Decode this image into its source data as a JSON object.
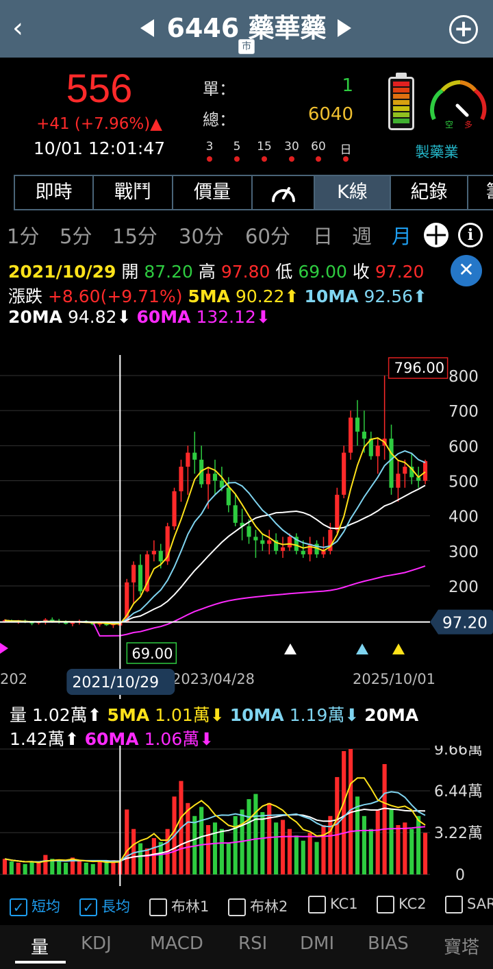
{
  "header": {
    "code": "6446",
    "name": "藥華藥",
    "title": "6446 藥華藥",
    "market_tag": "市"
  },
  "quote": {
    "price": "556",
    "change": "+41 (+7.96%)▲",
    "time": "10/01 12:01:47",
    "single_label": "單：",
    "single_value": "1",
    "total_label": "總：",
    "total_value": "6040",
    "intervals": [
      "3",
      "5",
      "15",
      "30",
      "60",
      "日"
    ],
    "industry": "製藥業",
    "gauge": {
      "left_label": "空",
      "right_label": "多"
    }
  },
  "tabs": [
    "即時",
    "戰鬥",
    "價量",
    "",
    "K線",
    "紀錄",
    "籌"
  ],
  "active_tab": "K線",
  "periods": [
    "1分",
    "5分",
    "15分",
    "30分",
    "60分",
    "日",
    "週",
    "月"
  ],
  "active_period": "月",
  "ohlc": {
    "date": "2021/10/29",
    "open_label": "開",
    "open": "87.20",
    "high_label": "高",
    "high": "97.80",
    "low_label": "低",
    "low": "69.00",
    "close_label": "收",
    "close": "97.20",
    "chg_label": "漲跌",
    "chg": "+8.60(+9.71%)",
    "ma5_label": "5MA",
    "ma5": "90.22",
    "ma10_label": "10MA",
    "ma10": "92.56",
    "ma20_label": "20MA",
    "ma20": "94.82",
    "ma60_label": "60MA",
    "ma60": "132.12"
  },
  "price_chart": {
    "y_ticks": [
      "800",
      "700",
      "600",
      "500",
      "400",
      "300",
      "200"
    ],
    "max_label": "796.00",
    "min_label": "69.00",
    "crosshair_price": "97.20",
    "x_labels": [
      "202",
      "2023/04/28",
      "2025/10/01"
    ],
    "crosshair_date": "2021/10/29"
  },
  "volume": {
    "label": "量",
    "value": "1.02萬",
    "ma5_label": "5MA",
    "ma5": "1.01萬",
    "ma10_label": "10MA",
    "ma10": "1.19萬",
    "ma20_label": "20MA",
    "ma20": "1.42萬",
    "ma60_label": "60MA",
    "ma60": "1.06萬",
    "y_ticks": [
      "9.66萬",
      "6.44萬",
      "3.22萬",
      "0"
    ]
  },
  "overlays": [
    {
      "label": "短均",
      "checked": true
    },
    {
      "label": "長均",
      "checked": true
    },
    {
      "label": "布林1",
      "checked": false
    },
    {
      "label": "布林2",
      "checked": false
    },
    {
      "label": "KC1",
      "checked": false
    },
    {
      "label": "KC2",
      "checked": false
    },
    {
      "label": "SAR",
      "checked": false
    }
  ],
  "indicator_tabs": [
    "量",
    "KDJ",
    "MACD",
    "RSI",
    "DMI",
    "BIAS",
    "寶塔"
  ],
  "active_indicator": "量",
  "colors": {
    "up": "#ff2a2a",
    "down": "#2ecc40",
    "ma5": "#ffe21a",
    "ma10": "#7fd4f0",
    "ma20": "#ffffff",
    "ma60": "#ff2aff",
    "header": "#4a6478",
    "accent": "#1e9ef0"
  },
  "chart_data": {
    "type": "candlestick",
    "title": "",
    "period": "monthly",
    "ylabel": "",
    "ylim": [
      0,
      850
    ],
    "last_close": 556,
    "max_high": 796,
    "min_low": 69,
    "candles_ohlc": [
      [
        100,
        105,
        95,
        102
      ],
      [
        102,
        104,
        96,
        98
      ],
      [
        98,
        103,
        92,
        100
      ],
      [
        100,
        104,
        94,
        96
      ],
      [
        96,
        100,
        88,
        94
      ],
      [
        94,
        99,
        90,
        97
      ],
      [
        97,
        108,
        90,
        104
      ],
      [
        104,
        110,
        95,
        100
      ],
      [
        100,
        106,
        93,
        96
      ],
      [
        96,
        102,
        90,
        92
      ],
      [
        92,
        100,
        85,
        97
      ],
      [
        97,
        104,
        90,
        100
      ],
      [
        100,
        102,
        94,
        95
      ],
      [
        95,
        98,
        88,
        90
      ],
      [
        90,
        96,
        84,
        93
      ],
      [
        93,
        98,
        86,
        88
      ],
      [
        88,
        94,
        80,
        92
      ],
      [
        87.2,
        97.8,
        69,
        97.2
      ],
      [
        97,
        220,
        95,
        210
      ],
      [
        210,
        270,
        150,
        260
      ],
      [
        260,
        290,
        175,
        185
      ],
      [
        185,
        300,
        182,
        290
      ],
      [
        290,
        330,
        270,
        300
      ],
      [
        300,
        320,
        250,
        270
      ],
      [
        270,
        380,
        260,
        370
      ],
      [
        370,
        480,
        360,
        470
      ],
      [
        470,
        560,
        440,
        540
      ],
      [
        540,
        600,
        460,
        580
      ],
      [
        580,
        640,
        520,
        560
      ],
      [
        560,
        600,
        480,
        490
      ],
      [
        490,
        540,
        420,
        520
      ],
      [
        520,
        560,
        460,
        500
      ],
      [
        500,
        540,
        470,
        480
      ],
      [
        480,
        510,
        410,
        430
      ],
      [
        430,
        460,
        370,
        380
      ],
      [
        380,
        420,
        330,
        370
      ],
      [
        370,
        390,
        320,
        340
      ],
      [
        340,
        360,
        280,
        330
      ],
      [
        330,
        350,
        300,
        320
      ],
      [
        320,
        360,
        290,
        330
      ],
      [
        330,
        350,
        290,
        300
      ],
      [
        300,
        340,
        280,
        310
      ],
      [
        310,
        350,
        300,
        340
      ],
      [
        340,
        350,
        290,
        300
      ],
      [
        300,
        330,
        280,
        290
      ],
      [
        290,
        340,
        270,
        320
      ],
      [
        320,
        330,
        280,
        290
      ],
      [
        290,
        340,
        280,
        300
      ],
      [
        300,
        380,
        290,
        360
      ],
      [
        360,
        480,
        350,
        460
      ],
      [
        460,
        600,
        450,
        580
      ],
      [
        580,
        700,
        560,
        680
      ],
      [
        680,
        730,
        600,
        640
      ],
      [
        640,
        700,
        580,
        620
      ],
      [
        620,
        640,
        560,
        570
      ],
      [
        570,
        620,
        520,
        600
      ],
      [
        600,
        800,
        560,
        620
      ],
      [
        620,
        660,
        460,
        480
      ],
      [
        480,
        560,
        440,
        520
      ],
      [
        520,
        560,
        480,
        540
      ],
      [
        540,
        580,
        490,
        510
      ],
      [
        510,
        540,
        480,
        500
      ],
      [
        500,
        560,
        490,
        556
      ]
    ],
    "volume_wan": [
      1.2,
      1.0,
      0.9,
      0.8,
      1.0,
      0.9,
      1.5,
      1.2,
      1.0,
      0.9,
      1.3,
      1.1,
      0.9,
      0.8,
      1.0,
      0.9,
      1.1,
      1.02,
      5.0,
      3.5,
      2.4,
      2.0,
      2.8,
      2.5,
      3.5,
      6.0,
      7.2,
      5.5,
      4.5,
      5.2,
      3.8,
      4.0,
      3.5,
      2.4,
      4.5,
      5.0,
      5.8,
      6.2,
      4.8,
      5.5,
      4.0,
      4.2,
      3.5,
      3.0,
      2.6,
      3.2,
      2.5,
      3.8,
      4.5,
      7.5,
      9.5,
      9.66,
      6.0,
      4.5,
      3.5,
      5.0,
      8.5,
      5.0,
      3.8,
      4.0,
      3.5,
      4.5,
      3.2
    ]
  }
}
